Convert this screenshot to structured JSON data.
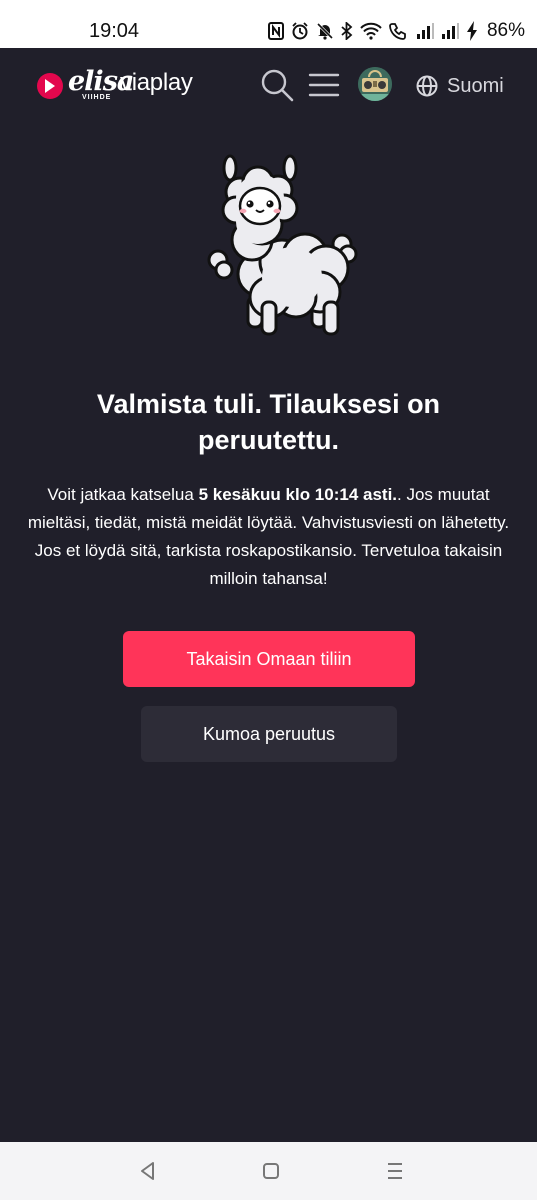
{
  "status_bar": {
    "time": "19:04",
    "battery": "86%",
    "icons": [
      "nfc-icon",
      "alarm-icon",
      "mute-icon",
      "bluetooth-icon",
      "wifi-icon",
      "call-icon",
      "signal-icon",
      "signal-icon",
      "charging-icon"
    ]
  },
  "header": {
    "brand_elisa": "elisa",
    "brand_sub": "VIIHDE",
    "brand_viaplay": "viaplay",
    "language": "Suomi",
    "icons": [
      "search-icon",
      "menu-icon",
      "avatar",
      "globe-icon"
    ]
  },
  "main": {
    "title": "Valmista tuli. Tilauksesi on peruutettu.",
    "body_before": "Voit jatkaa katselua ",
    "body_bold": "5 kesäkuu klo 10:14 asti.",
    "body_after": ". Jos muutat mieltäsi, tiedät, mistä meidät löytää. Vahvistusviesti on lähetetty. Jos et löydä sitä, tarkista roskapostikansio. Tervetuloa takaisin milloin tahansa!",
    "primary_button": "Takaisin Omaan tiliin",
    "secondary_button": "Kumoa peruutus"
  },
  "colors": {
    "background": "#201f2a",
    "accent": "#ff3459",
    "secondary_button": "#2d2c37"
  },
  "nav_bar": {
    "icons": [
      "back-icon",
      "home-icon",
      "recents-icon"
    ]
  }
}
